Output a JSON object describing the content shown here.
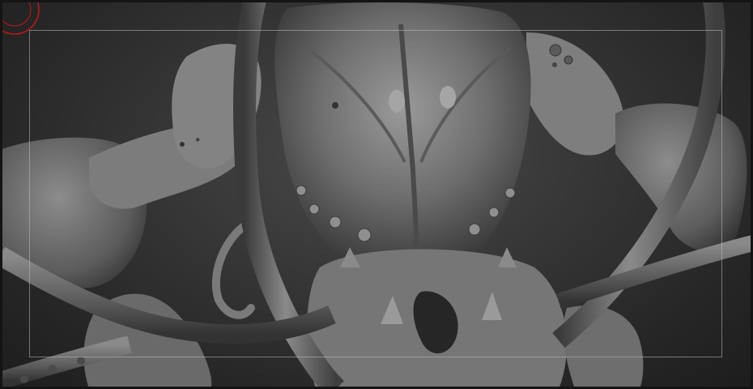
{
  "viewport": {
    "subject": "sculpt-model",
    "accent_color": "#c01818",
    "background_color": "#2a2a2a"
  },
  "gizmo": {
    "icon": "orbit-gizmo-icon",
    "color": "#c01818"
  }
}
